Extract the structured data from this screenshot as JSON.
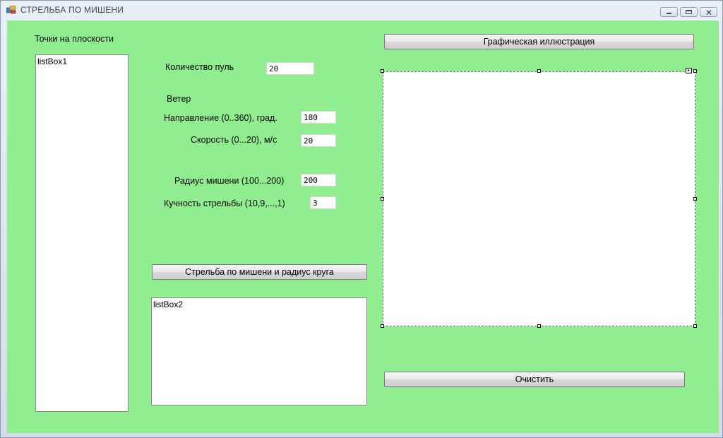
{
  "window": {
    "title": "СТРЕЛЬБА ПО МИШЕНИ"
  },
  "labels": {
    "points_on_plane": "Точки на плоскости",
    "bullet_count": "Количество пуль",
    "wind": "Ветер",
    "direction": "Направление (0..360), град.",
    "speed": "Скорость (0...20), м/с",
    "target_radius": "Радиус мишени (100...200)",
    "accuracy": "Кучность стрельбы  (10,9,...,1)"
  },
  "inputs": {
    "bullet_count": "20",
    "direction": "180",
    "speed": "20",
    "target_radius": "200",
    "accuracy": "3"
  },
  "listboxes": {
    "listbox1": "listBox1",
    "listbox2": "listBox2"
  },
  "buttons": {
    "illustration": "Графическая иллюстрация",
    "shoot": "Стрельба по мишени и радиус круга",
    "clear": "Очистить"
  }
}
